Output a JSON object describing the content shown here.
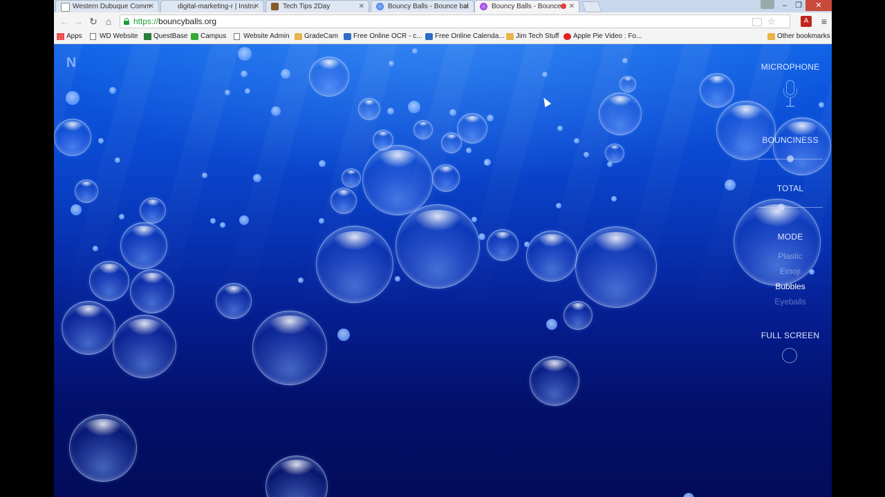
{
  "browser": {
    "tabs": [
      {
        "title": "Western Dubuque Comm",
        "active": false
      },
      {
        "title": "digital-marketing-r | Instru",
        "active": false
      },
      {
        "title": "Tech Tips 2Day",
        "active": false
      },
      {
        "title": "Bouncy Balls - Bounce bal",
        "active": false
      },
      {
        "title": "Bouncy Balls - Bounce",
        "active": true
      }
    ],
    "tab_close_glyph": "✕",
    "window_controls": {
      "minimize": "–",
      "maximize": "❐",
      "close": "✕"
    },
    "url_scheme": "https://",
    "url_host": "bouncyballs.org",
    "bookmarks": [
      {
        "label": "Apps",
        "icon": "apps-grid-icon"
      },
      {
        "label": "WD Website",
        "icon": "page-icon"
      },
      {
        "label": "QuestBase",
        "icon": "questbase-icon"
      },
      {
        "label": "Campus",
        "icon": "campus-icon"
      },
      {
        "label": "Website Admin",
        "icon": "page-icon"
      },
      {
        "label": "GradeCam",
        "icon": "folder-icon"
      },
      {
        "label": "Free Online OCR - c...",
        "icon": "ocr-icon"
      },
      {
        "label": "Free Online Calenda...",
        "icon": "calendar-icon"
      },
      {
        "label": "Jim Tech Stuff",
        "icon": "folder-icon"
      },
      {
        "label": "Apple Pie Video : Fo...",
        "icon": "video-icon"
      }
    ],
    "other_bookmarks": "Other bookmarks"
  },
  "app": {
    "logo_glyph": "N",
    "panel": {
      "microphone": "MICROPHONE",
      "bounciness": "BOUNCINESS",
      "bounciness_value": 0.5,
      "total": "TOTAL",
      "total_value": 0.35,
      "mode": "MODE",
      "mode_options": [
        {
          "label": "Plastic",
          "selected": false
        },
        {
          "label": "Emoji",
          "selected": false
        },
        {
          "label": "Bubbles",
          "selected": true
        },
        {
          "label": "Eyeballs",
          "selected": false
        }
      ],
      "full_screen": "FULL SCREEN"
    }
  },
  "colors": {
    "water_top": "#0d5fe6",
    "water_bottom": "#020c5a",
    "panel_text": "#dfe9ff",
    "secure_green": "#1e9a36"
  }
}
